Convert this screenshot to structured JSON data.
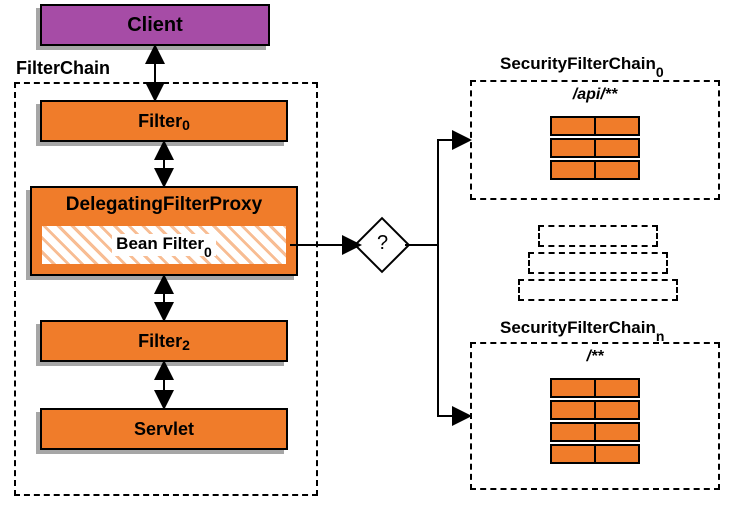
{
  "client": {
    "label": "Client"
  },
  "filterchain": {
    "label": "FilterChain"
  },
  "filter0": {
    "label": "Filter",
    "sub": "0"
  },
  "delegating": {
    "label": "DelegatingFilterProxy"
  },
  "beanfilter": {
    "label": "Bean Filter",
    "sub": "0"
  },
  "filter2": {
    "label": "Filter",
    "sub": "2"
  },
  "servlet": {
    "label": "Servlet"
  },
  "decision": {
    "label": "?"
  },
  "sfc0": {
    "label": "SecurityFilterChain",
    "sub": "0",
    "pattern": "/api/**"
  },
  "sfcn": {
    "label": "SecurityFilterChain",
    "sub": "n",
    "pattern": "/**"
  },
  "chart_data": {
    "type": "flow-diagram",
    "nodes": [
      {
        "id": "client",
        "label": "Client"
      },
      {
        "id": "filterchain",
        "label": "FilterChain",
        "children": [
          {
            "id": "filter0",
            "label": "Filter0"
          },
          {
            "id": "dfp",
            "label": "DelegatingFilterProxy",
            "children": [
              {
                "id": "beanfilter0",
                "label": "Bean Filter0"
              }
            ]
          },
          {
            "id": "filter2",
            "label": "Filter2"
          },
          {
            "id": "servlet",
            "label": "Servlet"
          }
        ]
      },
      {
        "id": "decision",
        "label": "?"
      },
      {
        "id": "sfc0",
        "label": "SecurityFilterChain0",
        "pattern": "/api/**",
        "filters": 3
      },
      {
        "id": "ellipsis",
        "label": "..."
      },
      {
        "id": "sfcn",
        "label": "SecurityFilterChainn",
        "pattern": "/**",
        "filters": 4
      }
    ],
    "edges": [
      {
        "from": "client",
        "to": "filter0",
        "bidir": true
      },
      {
        "from": "filter0",
        "to": "dfp",
        "bidir": true
      },
      {
        "from": "dfp",
        "to": "filter2",
        "bidir": true
      },
      {
        "from": "filter2",
        "to": "servlet",
        "bidir": true
      },
      {
        "from": "beanfilter0",
        "to": "decision"
      },
      {
        "from": "decision",
        "to": "sfc0"
      },
      {
        "from": "decision",
        "to": "sfcn"
      }
    ]
  }
}
